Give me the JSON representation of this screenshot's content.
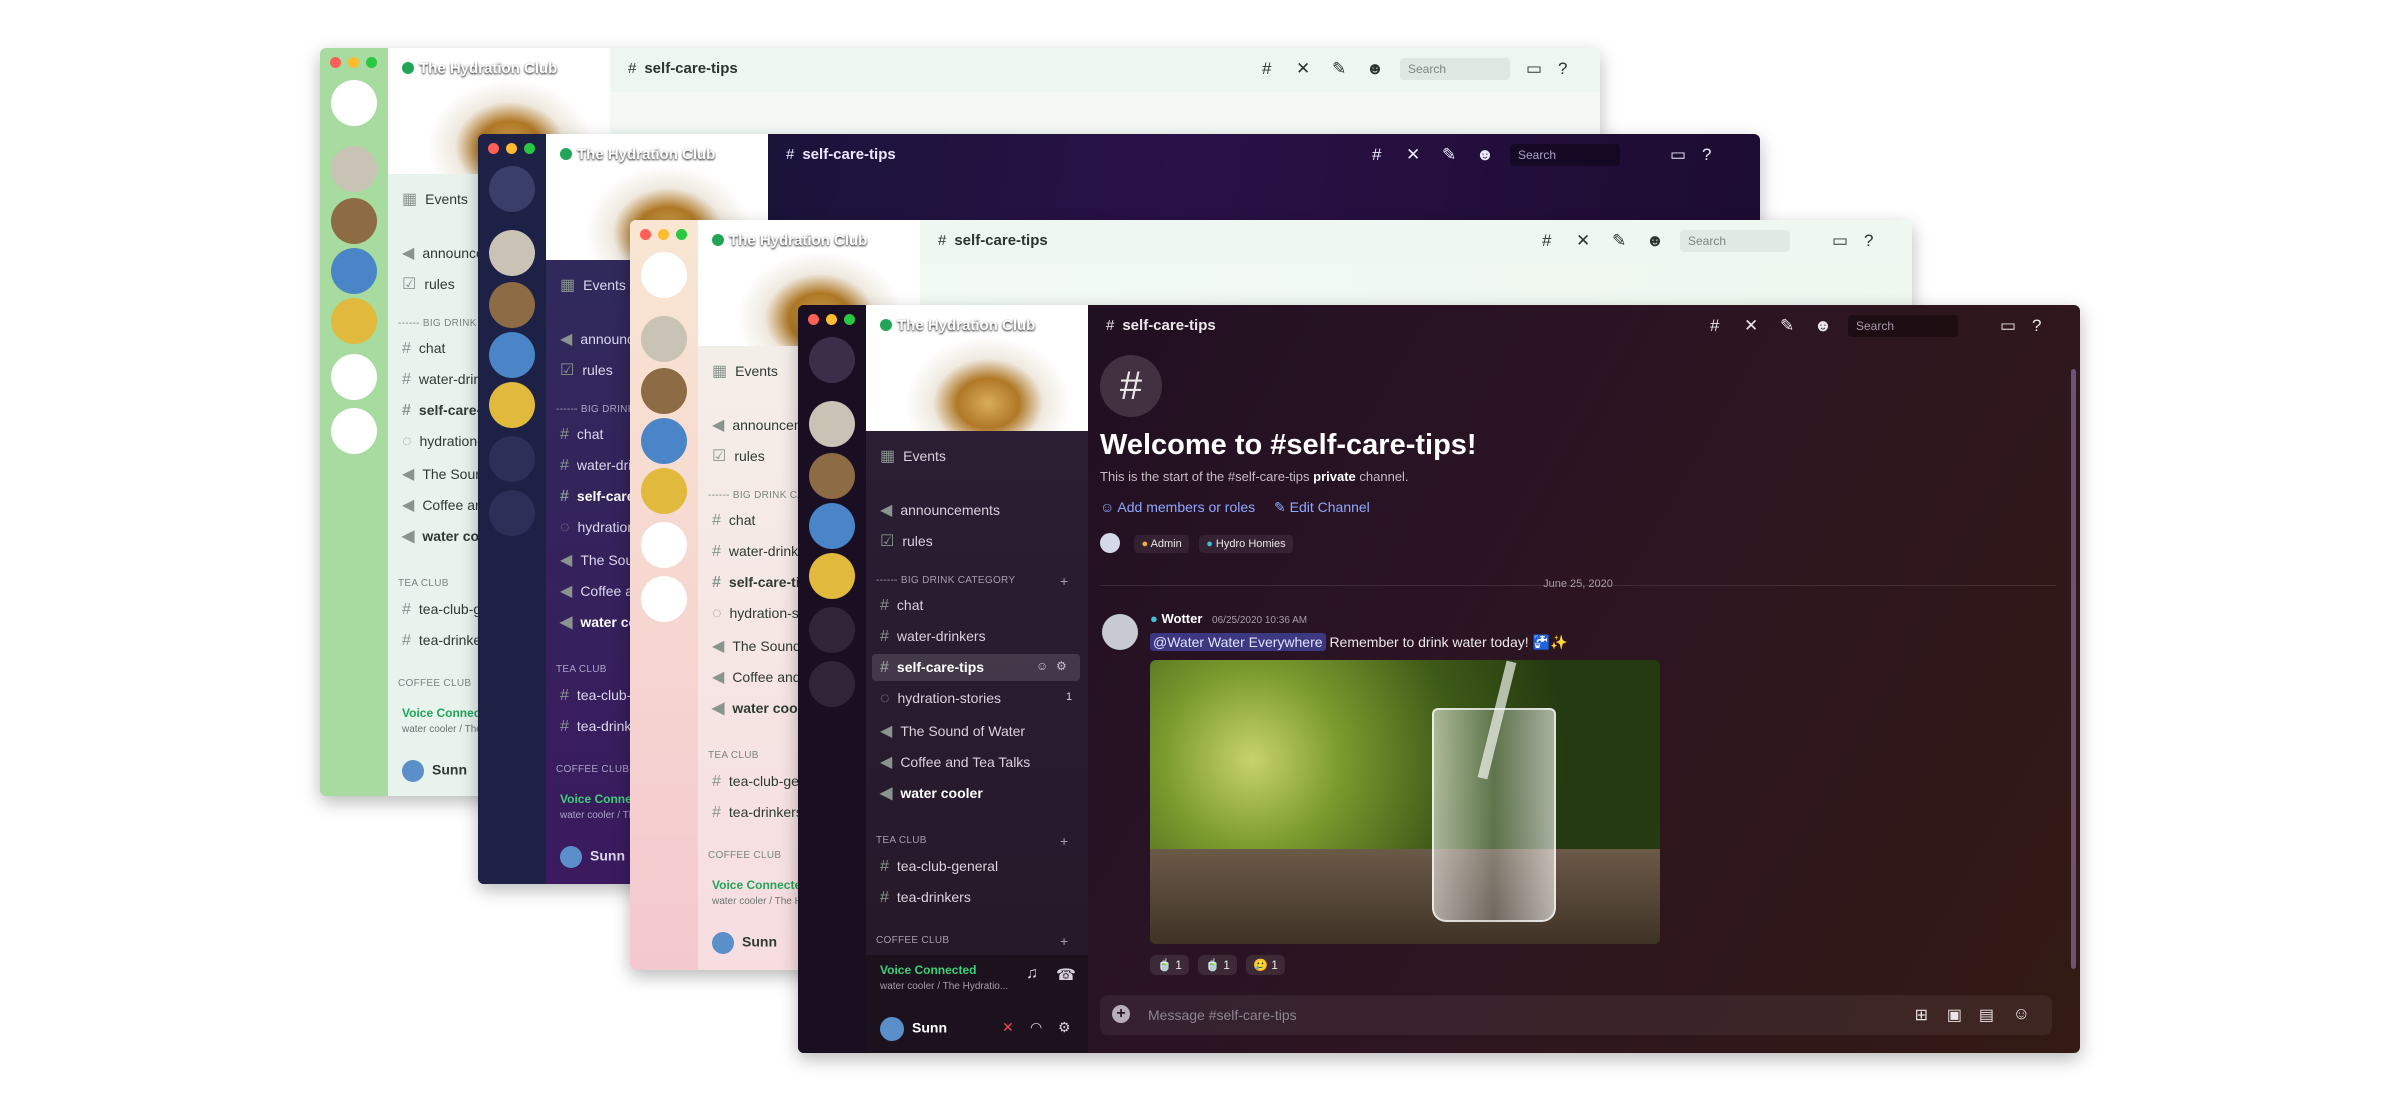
{
  "server": {
    "name": "The Hydration Club"
  },
  "channel": {
    "name": "self-care-tips"
  },
  "search": {
    "placeholder": "Search"
  },
  "sidebar": {
    "events": "Events",
    "announcements": "announcements",
    "rules": "rules",
    "cat_big_drink": "------ BIG DRINK CATEGORY",
    "chat": "chat",
    "water_drinkers": "water-drinkers",
    "self_care_tips": "self-care-tips",
    "hydration_stories": "hydration-stories",
    "hydration_count": "1",
    "sound_of_water": "The Sound of Water",
    "coffee_tea": "Coffee and Tea Talks",
    "water_cooler": "water cooler",
    "cat_tea_club": "TEA CLUB",
    "tea_club_general": "tea-club-general",
    "tea_drinkers": "tea-drinkers",
    "cat_coffee_club": "COFFEE CLUB"
  },
  "voice": {
    "status": "Voice Connected",
    "location": "water cooler / The Hydratio..."
  },
  "user": {
    "name": "Sunn"
  },
  "welcome": {
    "title": "Welcome to #self-care-tips!",
    "desc_prefix": "This is the start of the #self-care-tips ",
    "desc_bold": "private",
    "desc_suffix": " channel.",
    "add_members": "Add members or roles",
    "edit_channel": "Edit Channel",
    "roles": [
      "Admin",
      "Hydro Homies"
    ]
  },
  "divider_date": "June 25, 2020",
  "message": {
    "author": "Wotter",
    "timestamp": "06/25/2020 10:36 AM",
    "mention": "@Water Water Everywhere",
    "text": "Remember to drink water today!",
    "reactions": [
      {
        "emoji": "🍵",
        "count": "1"
      },
      {
        "emoji": "🍵",
        "count": "1"
      },
      {
        "emoji": "🥲",
        "count": "1"
      }
    ]
  },
  "composer": {
    "placeholder": "Message #self-care-tips"
  },
  "colors": {
    "accent": "#5865f2",
    "online": "#23a559",
    "link": "#8fa8ff"
  }
}
